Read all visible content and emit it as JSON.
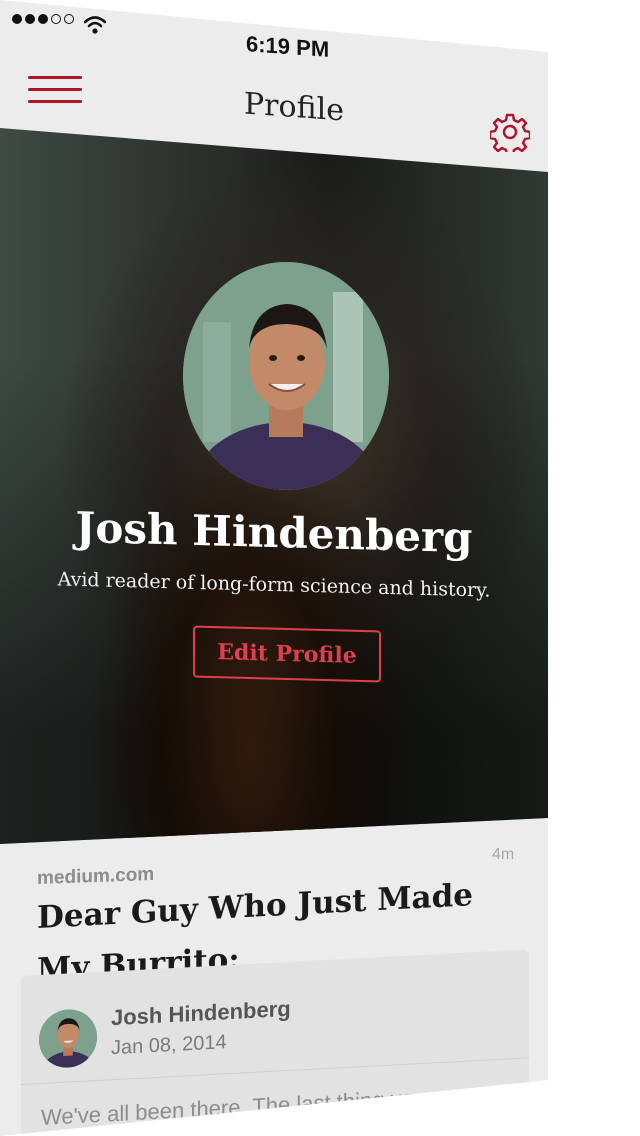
{
  "status_bar": {
    "time": "6:19 PM",
    "signal_filled": 3,
    "signal_total": 5
  },
  "nav": {
    "title": "Profile",
    "menu_icon": "hamburger-menu-icon",
    "settings_icon": "gear-icon",
    "accent_color": "#b0122a"
  },
  "profile": {
    "name": "Josh Hindenberg",
    "bio": "Avid reader of long-form science and history.",
    "edit_label": "Edit Profile",
    "button_color": "#e0404e"
  },
  "feed": {
    "age": "4m",
    "domain": "medium.com",
    "title": "Dear Guy Who Just Made My Burrito:",
    "author": "Josh Hindenberg",
    "date": "Jan 08, 2014",
    "excerpt": "We've all been there. The last thing you want"
  }
}
